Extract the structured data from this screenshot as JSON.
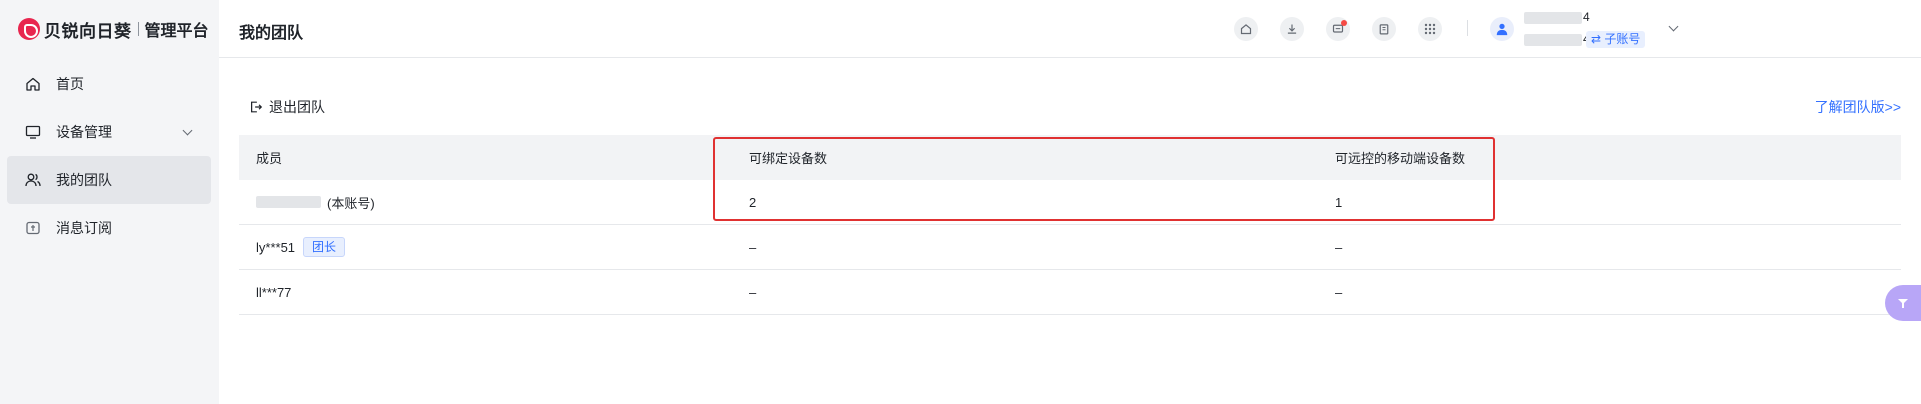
{
  "brand": {
    "name": "贝锐向日葵",
    "subtitle": "管理平台"
  },
  "sidebar": {
    "items": [
      {
        "label": "首页",
        "icon": "home-icon",
        "active": false
      },
      {
        "label": "设备管理",
        "icon": "monitor-icon",
        "active": false,
        "expandable": true
      },
      {
        "label": "我的团队",
        "icon": "users-icon",
        "active": true
      },
      {
        "label": "消息订阅",
        "icon": "subscription-icon",
        "active": false
      }
    ]
  },
  "header": {
    "title": "我的团队",
    "icons": [
      "home-icon",
      "download-icon",
      "message-icon",
      "clipboard-icon",
      "apps-grid-icon"
    ],
    "user": {
      "line1_suffix": "4",
      "line2_suffix": "4",
      "sub_account_label": "⇄ 子账号"
    }
  },
  "toolbar": {
    "exit_team_label": "退出团队",
    "learn_more_label": "了解团队版>>"
  },
  "table": {
    "headers": [
      "成员",
      "可绑定设备数",
      "可远控的移动端设备数"
    ],
    "rows": [
      {
        "member": "(本账号)",
        "tag": "",
        "bindable": "2",
        "mobile": "1"
      },
      {
        "member": "ly***51",
        "tag": "团长",
        "bindable": "–",
        "mobile": "–"
      },
      {
        "member": "ll***77",
        "tag": "",
        "bindable": "–",
        "mobile": "–"
      }
    ]
  },
  "colors": {
    "accent": "#3370ff",
    "brand": "#e8264f",
    "highlight": "#e03131",
    "float_button": "#b8a6f7"
  }
}
